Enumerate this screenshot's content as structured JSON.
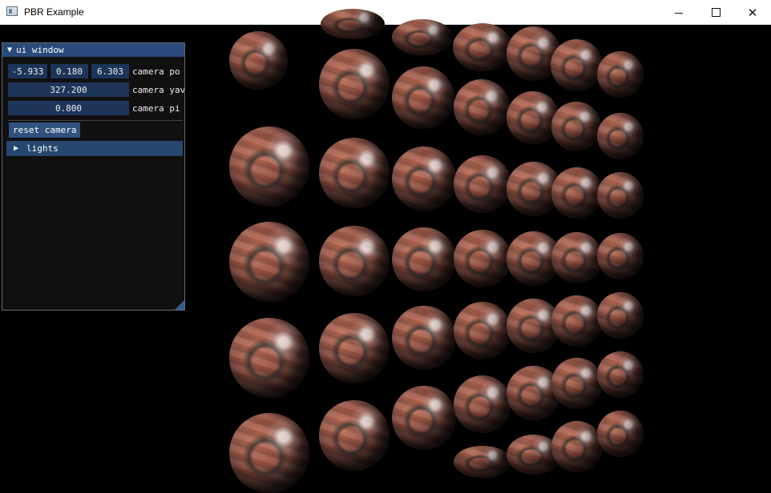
{
  "window": {
    "title": "PBR Example",
    "controls": [
      "minimize",
      "maximize",
      "close"
    ]
  },
  "scene": {
    "description_icon": "rusted-metal-sphere-grid"
  },
  "ui_window": {
    "title": "ui window",
    "camera_position": {
      "x": "-5.933",
      "y": "0.180",
      "z": "6.303",
      "label": "camera po"
    },
    "camera_yaw": {
      "value": "327.200",
      "label": "camera yav"
    },
    "camera_pitch": {
      "value": "0.800",
      "label": "camera pi"
    },
    "reset_button": "reset camera",
    "lights_header": "lights"
  },
  "colors": {
    "titlebar": "#ffffff",
    "ui_header": "#294a7a",
    "ui_background": "#101010",
    "slider": "#1d3558"
  }
}
